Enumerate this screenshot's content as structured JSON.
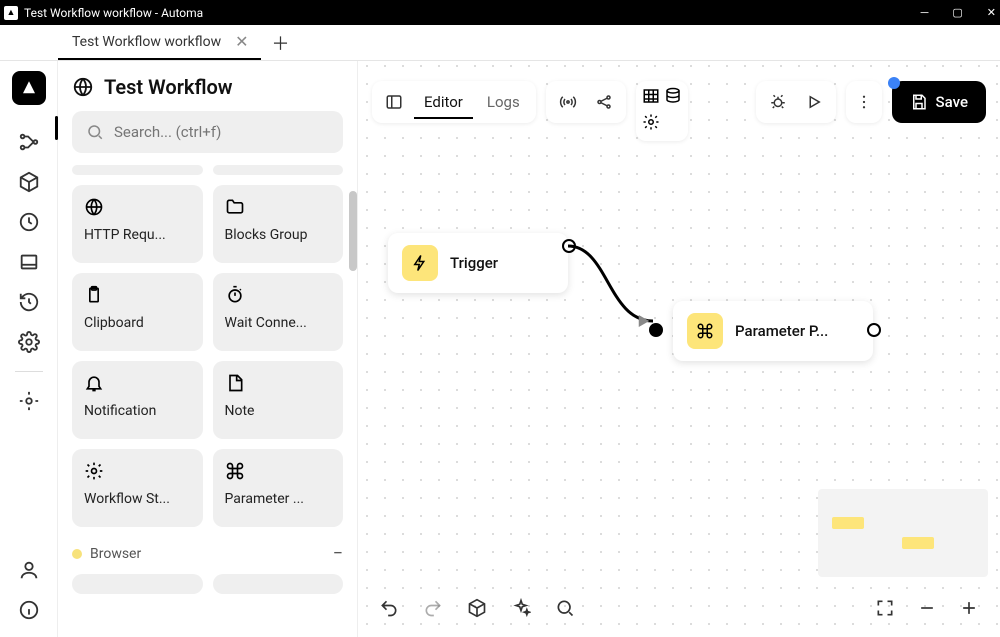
{
  "window": {
    "title": "Test Workflow workflow - Automa"
  },
  "tab": {
    "title": "Test Workflow workflow"
  },
  "workflow": {
    "title": "Test Workflow"
  },
  "search": {
    "placeholder": "Search... (ctrl+f)"
  },
  "blocks": [
    {
      "label": "HTTP Requ...",
      "icon": "globe"
    },
    {
      "label": "Blocks Group",
      "icon": "folder"
    },
    {
      "label": "Clipboard",
      "icon": "clipboard"
    },
    {
      "label": "Wait Conne...",
      "icon": "stopwatch"
    },
    {
      "label": "Notification",
      "icon": "bell"
    },
    {
      "label": "Note",
      "icon": "note"
    },
    {
      "label": "Workflow St...",
      "icon": "gear"
    },
    {
      "label": "Parameter ...",
      "icon": "command"
    }
  ],
  "section": {
    "browser": "Browser"
  },
  "canvas": {
    "tabs": {
      "editor": "Editor",
      "logs": "Logs"
    },
    "save": "Save",
    "nodes": {
      "trigger": "Trigger",
      "param": "Parameter P..."
    }
  }
}
